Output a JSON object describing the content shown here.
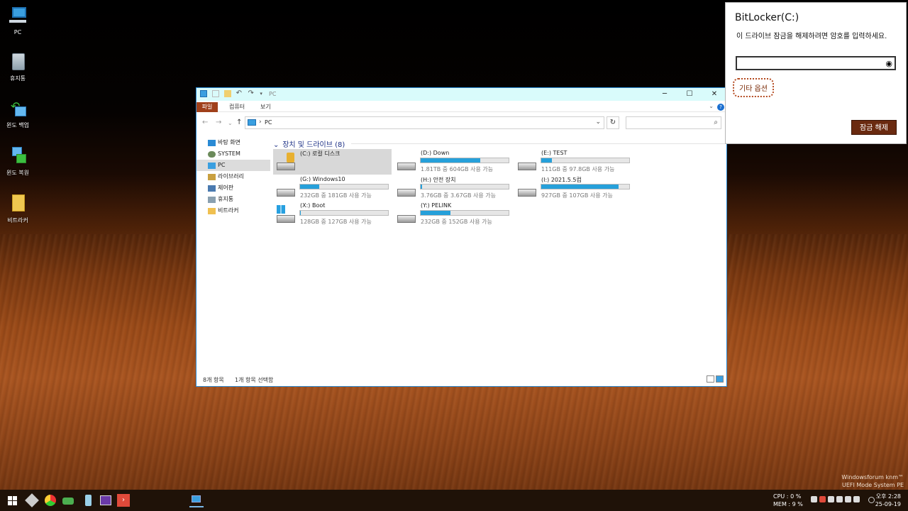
{
  "desktop": {
    "icons": [
      {
        "label": "PC"
      },
      {
        "label": "휴지통"
      },
      {
        "label": "윈도 백업"
      },
      {
        "label": "윈도 복원"
      },
      {
        "label": "비트라커"
      }
    ],
    "watermark": {
      "line1": "Windowsforum knm™",
      "line2": "UEFI Mode System PE"
    }
  },
  "explorer": {
    "title": "PC",
    "ribbon_tabs": [
      "파일",
      "컴퓨터",
      "보기"
    ],
    "address": "PC",
    "nav_arrow": "›",
    "sidebar": [
      {
        "label": "바탕 화면",
        "color": "#2a8ad4"
      },
      {
        "label": "SYSTEM",
        "color": "#6b8a5a"
      },
      {
        "label": "PC",
        "color": "#3a9fe0"
      },
      {
        "label": "라이브러리",
        "color": "#c9a040"
      },
      {
        "label": "제어판",
        "color": "#4a7ab0"
      },
      {
        "label": "휴지통",
        "color": "#8aa0b0"
      },
      {
        "label": "비트라커",
        "color": "#f0c050"
      }
    ],
    "group_label": "장치 및 드라이브 (8)",
    "drives": [
      {
        "name": "(C:) 로컬 디스크",
        "info": "",
        "used": 0
      },
      {
        "name": "(D:) Down",
        "info": "1.81TB 중 604GB 사용 가능",
        "used": 0.68
      },
      {
        "name": "(E:) TEST",
        "info": "111GB 중 97.8GB 사용 가능",
        "used": 0.12
      },
      {
        "name": "(G:) Windows10",
        "info": "232GB 중 181GB 사용 가능",
        "used": 0.22
      },
      {
        "name": "(H:) 안전 장치",
        "info": "3.76GB 중 3.67GB 사용 가능",
        "used": 0.02
      },
      {
        "name": "(I:) 2021.5.5컴",
        "info": "927GB 중 107GB 사용 가능",
        "used": 0.88
      },
      {
        "name": "(X:) Boot",
        "info": "128GB 중 127GB 사용 가능",
        "used": 0.01
      },
      {
        "name": "(Y:) PELINK",
        "info": "232GB 중 152GB 사용 가능",
        "used": 0.34
      }
    ],
    "status": {
      "items": "8개 항목",
      "selected": "1개 항목 선택함"
    }
  },
  "bitlocker": {
    "title": "BitLocker(C:)",
    "prompt": "이 드라이브 잠금을 해제하려면 암호를 입력하세요.",
    "password_value": "",
    "more_options": "기타 옵션",
    "unlock_button": "잠금 해제"
  },
  "taskbar": {
    "cpu_label": "CPU :",
    "cpu_value": "0 %",
    "mem_label": "MEM :",
    "mem_value": "9 %",
    "time": "오후 2:28",
    "date": "25-09-19"
  }
}
